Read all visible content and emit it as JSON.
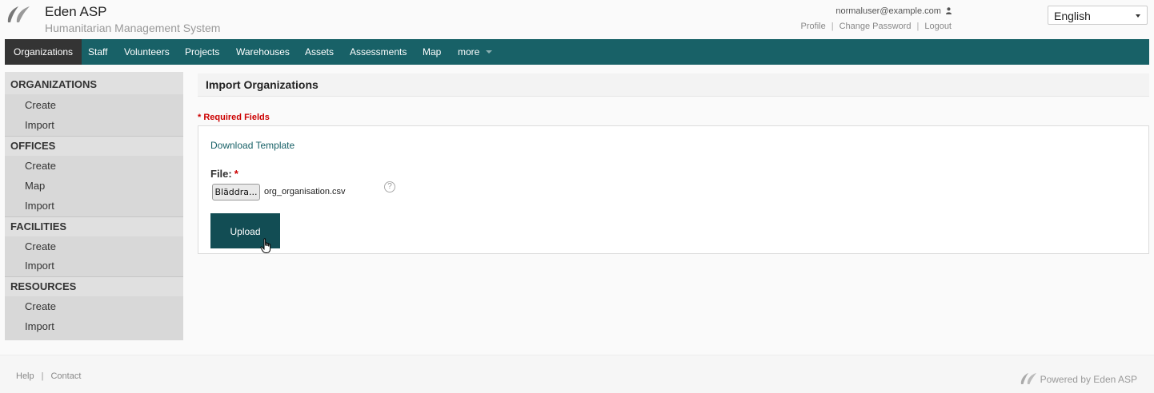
{
  "header": {
    "app_title": "Eden ASP",
    "app_subtitle": "Humanitarian Management System",
    "user_email": "normaluser@example.com",
    "links": {
      "profile": "Profile",
      "change_password": "Change Password",
      "logout": "Logout"
    },
    "language": "English"
  },
  "nav": {
    "items": [
      "Organizations",
      "Staff",
      "Volunteers",
      "Projects",
      "Warehouses",
      "Assets",
      "Assessments",
      "Map",
      "more"
    ]
  },
  "sidebar": {
    "organizations": {
      "title": "ORGANIZATIONS",
      "create": "Create",
      "import": "Import"
    },
    "offices": {
      "title": "OFFICES",
      "create": "Create",
      "map": "Map",
      "import": "Import"
    },
    "facilities": {
      "title": "FACILITIES",
      "create": "Create",
      "import": "Import"
    },
    "resources": {
      "title": "RESOURCES",
      "create": "Create",
      "import": "Import"
    }
  },
  "main": {
    "title": "Import Organizations",
    "required_note": "* Required Fields",
    "download_template": "Download Template",
    "file_label": "File:",
    "required_marker": "*",
    "browse_label": "Bläddra...",
    "file_name": "org_organisation.csv",
    "help_symbol": "?",
    "upload_label": "Upload"
  },
  "footer": {
    "help": "Help",
    "contact": "Contact",
    "powered_by": "Powered by Eden ASP"
  },
  "colors": {
    "nav_bg": "#186167",
    "nav_active": "#343434",
    "upload_button": "#124d54",
    "required": "#cc0000"
  }
}
